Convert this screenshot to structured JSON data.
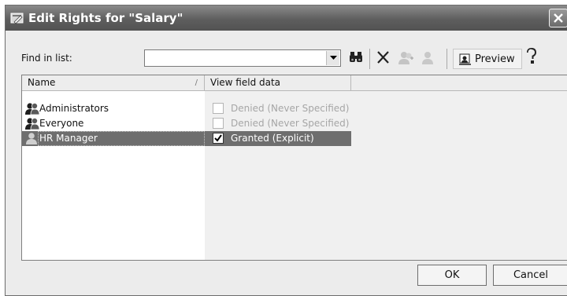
{
  "window": {
    "title": "Edit Rights for \"Salary\""
  },
  "find": {
    "label": "Find in list:",
    "value": ""
  },
  "toolbar": {
    "preview_label": "Preview",
    "icons": [
      "binoculars-icon",
      "delete-x-icon",
      "add-user-icon",
      "user-icon",
      "preview-icon",
      "help-icon"
    ]
  },
  "list": {
    "columns": [
      {
        "label": "Name",
        "sort": "/"
      },
      {
        "label": "View field data"
      }
    ],
    "rows": [
      {
        "name": "Administrators",
        "permission": "Denied (Never Specified)",
        "checked": false,
        "selected": false
      },
      {
        "name": "Everyone",
        "permission": "Denied (Never Specified)",
        "checked": false,
        "selected": false
      },
      {
        "name": "HR Manager",
        "permission": "Granted (Explicit)",
        "checked": true,
        "selected": true
      }
    ]
  },
  "buttons": {
    "ok": "OK",
    "cancel": "Cancel"
  }
}
